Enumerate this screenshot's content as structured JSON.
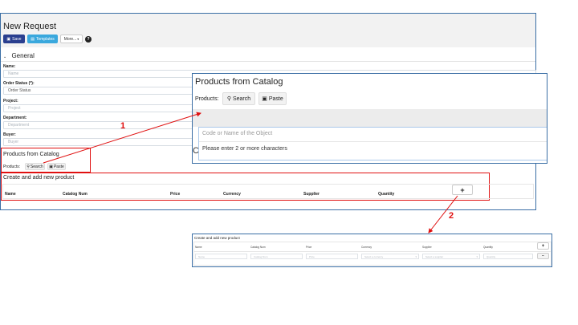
{
  "main": {
    "title": "New Request",
    "toolbar": {
      "save_label": "Save",
      "templates_label": "Templates",
      "more_label": "More...",
      "help_label": "?"
    },
    "section_general": "General",
    "fields": [
      {
        "label": "Name:",
        "placeholder": "Name"
      },
      {
        "label": "Order Status (*):",
        "placeholder": "Order Status"
      },
      {
        "label": "Project:",
        "placeholder": "Project"
      },
      {
        "label": "Department:",
        "placeholder": "Department"
      },
      {
        "label": "Buyer:",
        "placeholder": "Buyer"
      }
    ],
    "catalog": {
      "title": "Products from Catalog",
      "products_label": "Products:",
      "search_label": "Search",
      "paste_label": "Paste"
    },
    "create": {
      "title": "Create and add new product",
      "columns": [
        "Name",
        "Catalog Num",
        "Price",
        "Currency",
        "Supplier",
        "Quantity"
      ],
      "add_label": "+"
    }
  },
  "zoom_catalog": {
    "title": "Products from Catalog",
    "products_label": "Products:",
    "search_label": "Search",
    "paste_label": "Paste",
    "input_placeholder": "Code or Name of the Object",
    "hint": "Please enter 2 or more characters",
    "behind_char": "C"
  },
  "zoom_create": {
    "title": "Create and add new product",
    "columns": [
      "Name",
      "Catalog Num",
      "Price",
      "Currency",
      "Supplier",
      "Quantity"
    ],
    "placeholders": [
      "Name",
      "Catalog Num",
      "Price",
      "Select a currency",
      "Select a supplier",
      "Quantity"
    ],
    "add_label": "+",
    "remove_label": "−"
  },
  "annotations": {
    "callout_1": "1",
    "callout_2": "2"
  },
  "colors": {
    "primary": "#2a3f8f",
    "info": "#3aa8dd",
    "annotation": "#e01010",
    "frame": "#3a6ea5"
  }
}
